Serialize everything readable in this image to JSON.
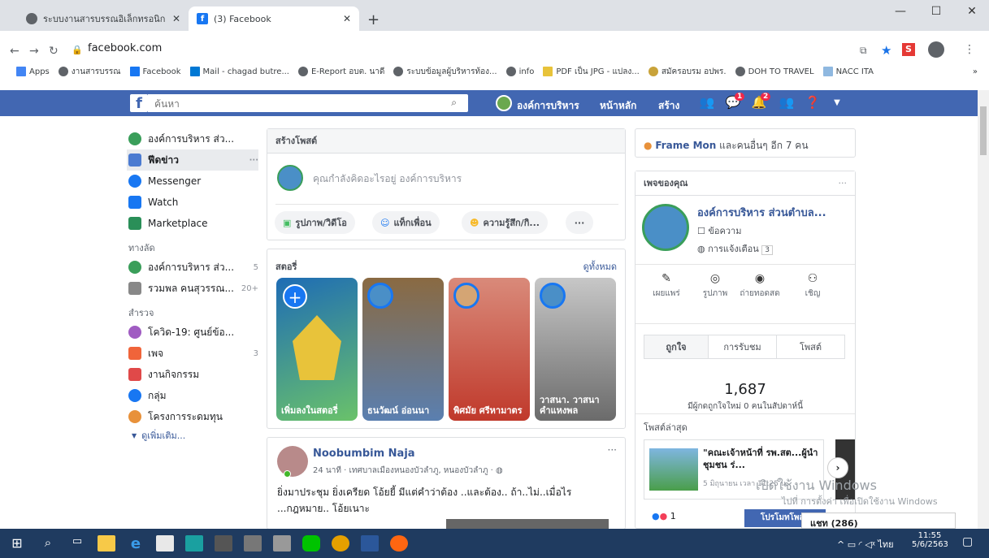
{
  "browser": {
    "tabs": [
      {
        "label": "ระบบงานสารบรรณอิเล็กทรอนิกส์ Sara"
      },
      {
        "label": "(3) Facebook"
      }
    ],
    "url": "facebook.com",
    "bookmarks": [
      "Apps",
      "งานสารบรรณ",
      "Facebook",
      "Mail - chagad butre...",
      "E-Report อบต. นาดี",
      "ระบบข้อมูลผู้บริหารท้อง...",
      "info",
      "PDF เป็น JPG - แปลง...",
      "สมัครอบรม อปพร.",
      "DOH TO TRAVEL",
      "NACC ITA"
    ],
    "bookmarks_more": "»"
  },
  "fb_header": {
    "search_placeholder": "ค้นหา",
    "profile_name": "องค์การบริหาร",
    "home": "หน้าหลัก",
    "create": "สร้าง",
    "messages_badge": "1",
    "notif_badge": "2"
  },
  "left_nav": {
    "profile": "องค์การบริหาร ส่ว...",
    "items": [
      {
        "label": "ฟีดข่าว",
        "extra": "···",
        "color": "#4b7bd1"
      },
      {
        "label": "Messenger",
        "extra": "",
        "color": "#1877f2"
      },
      {
        "label": "Watch",
        "extra": "",
        "color": "#1877f2"
      },
      {
        "label": "Marketplace",
        "extra": "",
        "color": "#2a8f58"
      }
    ],
    "shortcuts_title": "ทางลัด",
    "shortcuts": [
      {
        "label": "องค์การบริหาร ส่ว...",
        "count": "5",
        "color": "#3a9e5a"
      },
      {
        "label": "รวมพล คนสุวรรณ...",
        "count": "20+",
        "color": "#888"
      }
    ],
    "explore_title": "สำรวจ",
    "explore": [
      {
        "label": "โควิด-19: ศูนย์ข้อ...",
        "count": "",
        "color": "#a05cc2"
      },
      {
        "label": "เพจ",
        "count": "3",
        "color": "#f0643a"
      },
      {
        "label": "งานกิจกรรม",
        "count": "",
        "color": "#e04949"
      },
      {
        "label": "กลุ่ม",
        "count": "",
        "color": "#1877f2"
      },
      {
        "label": "โครงการระดมทุน",
        "count": "",
        "color": "#e8913a"
      }
    ],
    "see_more": "ดูเพิ่มเติม..."
  },
  "composer": {
    "title": "สร้างโพสต์",
    "placeholder": "คุณกำลังคิดอะไรอยู่ องค์การบริหาร",
    "photo": "รูปภาพ/วิดีโอ",
    "tag": "แท็กเพื่อน",
    "feeling": "ความรู้สึก/กิ...",
    "more": "···"
  },
  "stories": {
    "title": "สตอรี่",
    "see_all": "ดูทั้งหมด",
    "items": [
      {
        "name": "เพิ่มลงในสตอรี่",
        "color": "#1e6cb5"
      },
      {
        "name": "ธนวัฒน์ อ่อนนา",
        "color": "#8a6a42"
      },
      {
        "name": "พิศมัย ศรีหามาตร",
        "color": "#c0392b"
      },
      {
        "name": "วาสนา. วาสนา คำแหงพล",
        "color": "#6b6b6b"
      }
    ]
  },
  "post": {
    "author": "Noobumbim Naja",
    "meta": "24 นาที · เทศบาลเมืองหนองบัวลำภู, หนองบัวลำภู · ",
    "more": "···",
    "text1": "ยิ่งมาประชุม ยิ่งเครียด โอ้ยยี้ มีแต่คำว่าต้อง ..และต้อง.. ถ้า..ไม่..เมื่อไร",
    "text2": "...กฎหมาย.. โอ้ยเนาะ"
  },
  "right": {
    "frame_name": "Frame Mon",
    "frame_rest": " และคนอื่นๆ อีก 7 คน",
    "pages_title": "เพจของคุณ",
    "pages_more": "···",
    "page_name": "องค์การบริหาร ส่วนตำบล...",
    "messages": "ข้อความ",
    "notifications": "การแจ้งเตือน",
    "notif_count": "3",
    "actions": [
      "เผยแพร่",
      "รูปภาพ",
      "ถ่ายทอดสด",
      "เชิญ"
    ],
    "tabs": [
      "ถูกใจ",
      "การรับชม",
      "โพสต์"
    ],
    "likes": "1,687",
    "likes_sub": "มีผู้กดถูกใจใหม่ 0 คนในสัปดาห์นี้",
    "recent_title": "โพสต์ล่าสุด",
    "recent_text": "\"คณะเจ้าหน้าที่ รพ.สต...ผู้นำชุมชน ร่...",
    "recent_date": "5 มิถุนายน เวลา 11:25 น.",
    "reactions": "1",
    "promote": "โปรโมทโพสต์",
    "chat": "แชท (286)"
  },
  "windows": {
    "activate": "เปิดใช้งาน Windows",
    "activate_sub": "ไปที่ การตั้งค่า เพื่อเปิดใช้งาน Windows",
    "lang": "ไทย",
    "time": "11:55",
    "date": "5/6/2563"
  }
}
